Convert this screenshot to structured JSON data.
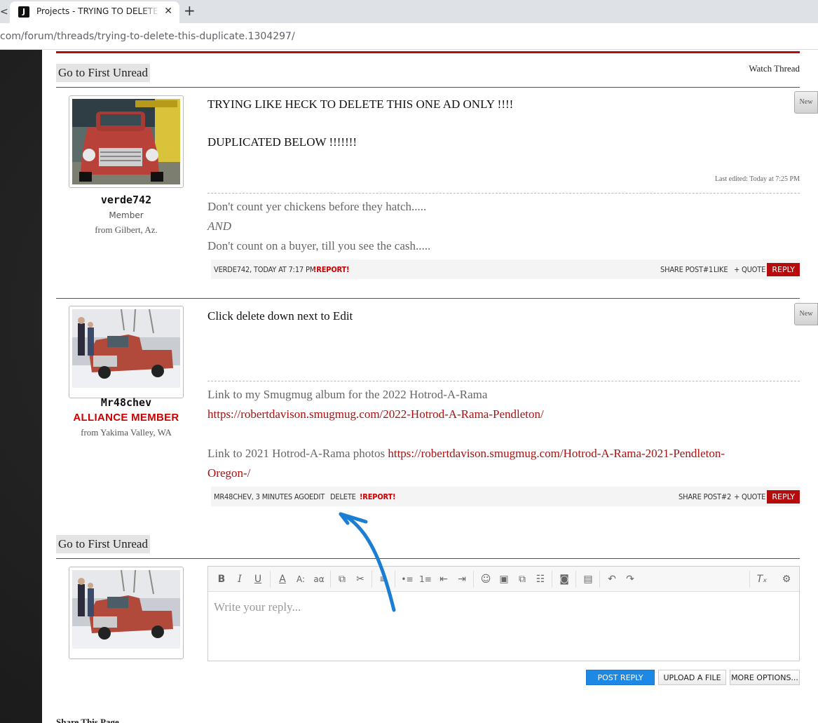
{
  "browser": {
    "tab_edge_glyph": "<",
    "tab_favicon": "J",
    "tab_title": "Projects - TRYING TO DELETE THIS",
    "tab_close": "✕",
    "new_tab": "+",
    "url": "com/forum/threads/trying-to-delete-this-duplicate.1304297/"
  },
  "thread": {
    "goto_unread_label": "Go to First Unread",
    "watch_thread_label": "Watch Thread"
  },
  "posts": [
    {
      "username": "verde742",
      "user_title": "Member",
      "location": "from Gilbert, Az.",
      "new_badge": "New",
      "message_lines": [
        "TRYING LIKE HECK TO DELETE THIS ONE AD ONLY !!!!",
        "",
        "DUPLICATED BELOW !!!!!!!"
      ],
      "last_edited": "Last edited: Today at 7:25 PM",
      "signature": {
        "line1": "Don't count yer chickens before they hatch.....",
        "line2": "AND",
        "line3": "Don't count on a buyer, till you see the cash....."
      },
      "meta": {
        "author_time": "VERDE742, TODAY AT 7:17 PM",
        "report": "!REPORT!",
        "share": "SHARE POST#1",
        "like": "LIKE",
        "quote": "+ QUOTE",
        "reply": "REPLY"
      }
    },
    {
      "username": "Mr48chev",
      "user_title": "ALLIANCE MEMBER",
      "location": "from Yakima Valley, WA",
      "new_badge": "New",
      "message": "Click delete down next to Edit",
      "signature": {
        "line1": "Link to my Smugmug album for the 2022 Hotrod-A-Rama",
        "link1": "https://robertdavison.smugmug.com/2022-Hotrod-A-Rama-Pendleton/",
        "line3_prefix": "Link to 2021 Hotrod-A-Rama photos ",
        "link2_part1": "https://robertdavison.smugmug.com/Hotrod-A-Rama-2021-Pendleton-",
        "link2_part2": "Oregon-/"
      },
      "meta": {
        "author_time": "MR48CHEV, 3 MINUTES AGO",
        "edit": "EDIT",
        "delete": "DELETE",
        "report": "!REPORT!",
        "share": "SHARE POST#2",
        "quote": "+ QUOTE",
        "reply": "REPLY"
      }
    }
  ],
  "editor": {
    "placeholder": "Write your reply...",
    "toolbar_icons": [
      "bold-icon",
      "italic-icon",
      "underline-icon",
      "text-color-icon",
      "font-size-icon",
      "font-family-icon",
      "link-icon",
      "unlink-icon",
      "align-icon",
      "bullet-list-icon",
      "numbered-list-icon",
      "outdent-icon",
      "indent-icon",
      "smilie-icon",
      "image-icon",
      "media-icon",
      "code-icon",
      "camera-icon",
      "save-draft-icon",
      "undo-icon",
      "redo-icon",
      "remove-format-icon",
      "toggle-bbcode-icon"
    ],
    "toolbar_glyphs": {
      "bold": "B",
      "italic": "I",
      "underline": "U",
      "text_color": "A",
      "font_size": "A:",
      "font_family": "aα",
      "link": "⧉",
      "unlink": "✂",
      "align": "≡",
      "bullets": "•≡",
      "numbers": "1≡",
      "outdent": "⇤",
      "indent": "⇥",
      "smilie": "☺",
      "image": "▣",
      "media": "⧉",
      "code": "☷",
      "camera": "◙",
      "save": "▤",
      "undo": "↶",
      "redo": "↷",
      "remove_format": "Tₓ",
      "toggle": "⚙"
    }
  },
  "actions": {
    "post_reply": "POST REPLY",
    "upload_file": "UPLOAD A FILE",
    "more_options": "MORE OPTIONS..."
  },
  "footer": {
    "share_title": "Share This Page"
  },
  "colors": {
    "accent_red": "#b50d0d",
    "annotation_blue": "#1a7fd4",
    "primary_button": "#1e88e5"
  }
}
